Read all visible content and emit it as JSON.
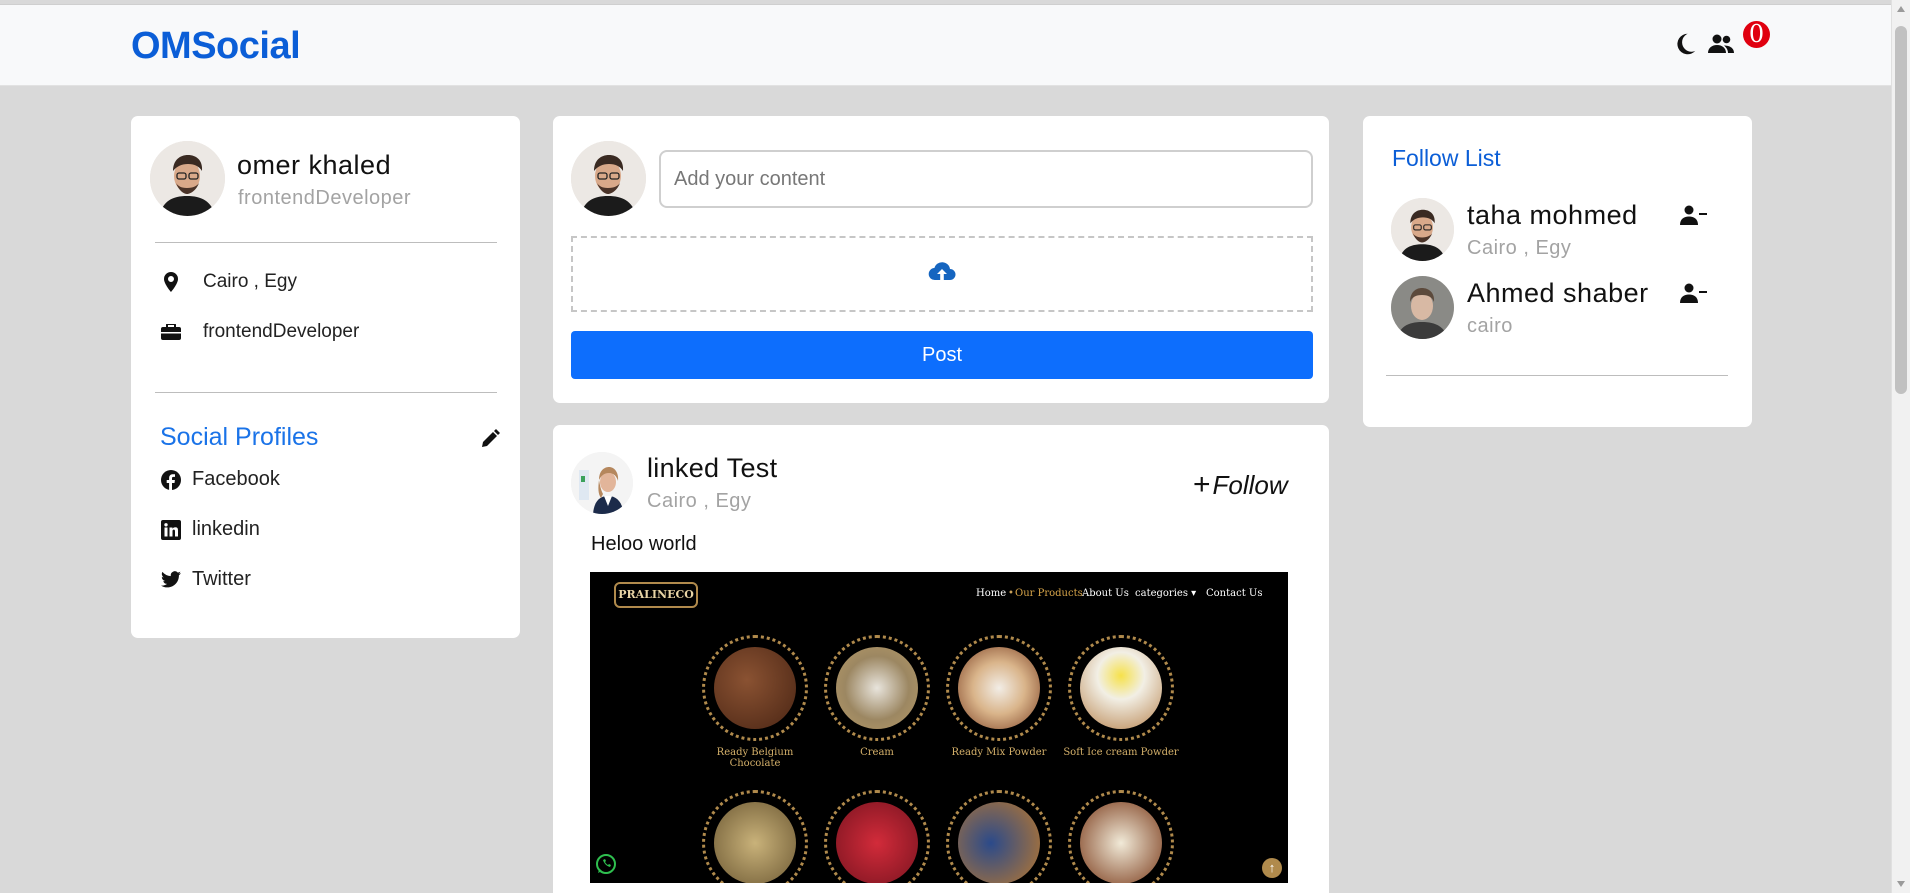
{
  "navbar": {
    "brand": "OMSocial",
    "notification_count": "0",
    "icons": [
      "moon-icon",
      "users-icon"
    ]
  },
  "profile": {
    "name": "omer khaled",
    "title": "frontendDeveloper",
    "location": "Cairo , Egy",
    "job": "frontendDeveloper",
    "social_title": "Social Profiles",
    "socials": [
      {
        "label": "Facebook",
        "icon": "facebook-icon"
      },
      {
        "label": "linkedin",
        "icon": "linkedin-icon"
      },
      {
        "label": "Twitter",
        "icon": "twitter-icon"
      }
    ]
  },
  "composer": {
    "placeholder": "Add your content",
    "post_label": "Post",
    "upload_icon": "cloud-upload-icon"
  },
  "post": {
    "author": "linked Test",
    "location": "Cairo , Egy",
    "follow_label": "Follow",
    "text": "Heloo world",
    "image": {
      "logo": "PRALINECO",
      "nav": [
        "Home",
        "Our Products",
        "About Us",
        "categories ▾",
        "Contact Us"
      ],
      "products": [
        "Ready Belgium Chocolate",
        "Cream",
        "Ready Mix Powder",
        "Soft Ice cream Powder"
      ]
    }
  },
  "follow_list": {
    "title": "Follow List",
    "users": [
      {
        "name": "taha mohmed",
        "location": "Cairo , Egy"
      },
      {
        "name": "Ahmed shaber",
        "location": "cairo"
      }
    ]
  },
  "colors": {
    "brand": "#0b5ed7",
    "primary_button": "#0d6efd",
    "badge": "#e0000f",
    "background": "#d9d9d9"
  }
}
